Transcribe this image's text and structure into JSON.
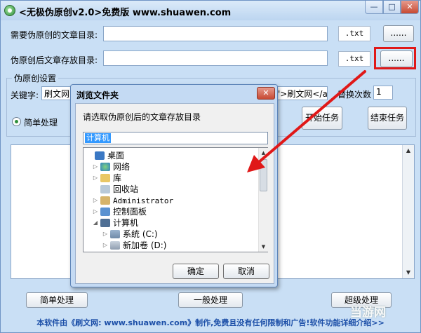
{
  "window": {
    "title": "<无极伪原创v2.0>免费版 www.shuawen.com",
    "minimize_glyph": "—",
    "maximize_glyph": "□",
    "close_glyph": "✕"
  },
  "row1": {
    "label": "需要伪原创的文章目录:",
    "value": "",
    "ext": ".txt",
    "browse": "......"
  },
  "row2": {
    "label": "伪原创后文章存放目录:",
    "value": "",
    "ext": ".txt",
    "browse": "......"
  },
  "settings": {
    "group_title": "伪原创设置",
    "keyword_label": "关键字:",
    "keyword_value": "刷文网",
    "link_value": "'>刷文网</a>",
    "replace_label": "替换次数",
    "replace_value": "1",
    "radio_label": "简单处理",
    "start_button": "开始任务",
    "stop_button": "结束任务"
  },
  "bottom_buttons": {
    "simple": "简单处理",
    "normal": "一般处理",
    "super": "超级处理"
  },
  "footer": "本软件由《刷文网: www.shuawen.com》制作,免费且没有任何限制和广告!软件功能详细介绍>>",
  "watermark": "当游网",
  "dialog": {
    "title": "浏览文件夹",
    "close_glyph": "✕",
    "prompt": "请选取伪原创后的文章存放目录",
    "selected": "计算机",
    "ok": "确定",
    "cancel": "取消",
    "tree": [
      {
        "label": "桌面",
        "icon": "desktop-icon"
      },
      {
        "label": "网络",
        "icon": "network-icon"
      },
      {
        "label": "库",
        "icon": "library-icon"
      },
      {
        "label": "回收站",
        "icon": "recycle-bin-icon"
      },
      {
        "label": "Administrator",
        "icon": "user-icon"
      },
      {
        "label": "控制面板",
        "icon": "control-panel-icon"
      },
      {
        "label": "计算机",
        "icon": "computer-icon"
      },
      {
        "label": "系统 (C:)",
        "icon": "drive-c-icon"
      },
      {
        "label": "新加卷 (D:)",
        "icon": "drive-d-icon"
      }
    ]
  },
  "colors": {
    "window_bg": "#c9dff5",
    "annotation": "#e01818",
    "footer_text": "#1c4fa8"
  }
}
